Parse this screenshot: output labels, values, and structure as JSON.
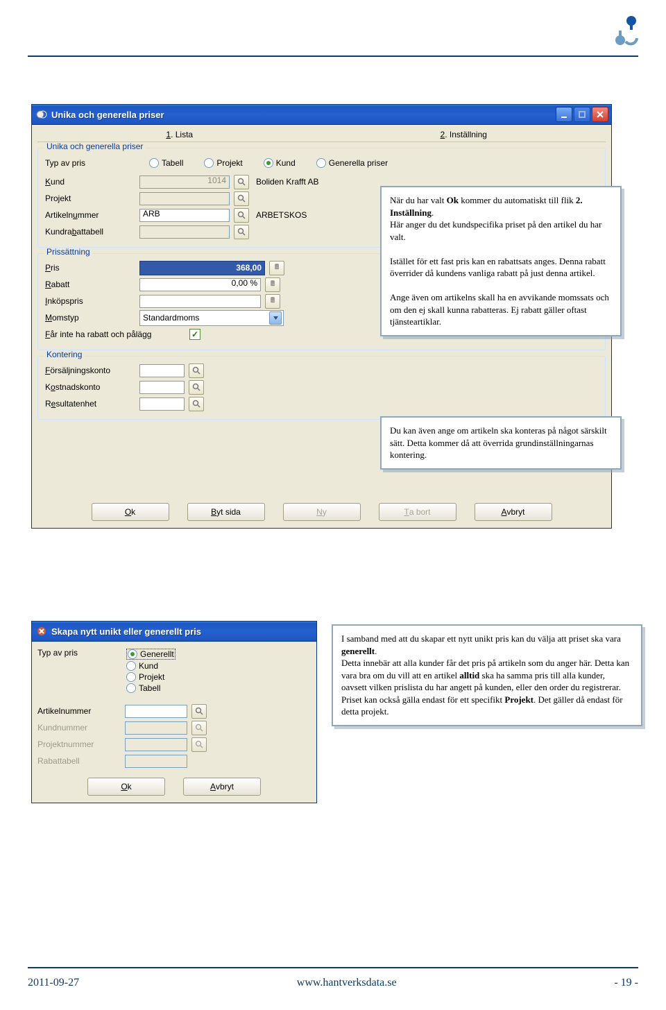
{
  "footer": {
    "date": "2011-09-27",
    "url": "www.hantverksdata.se",
    "page": "- 19 -"
  },
  "win1": {
    "title": "Unika och generella priser",
    "tabs": {
      "t1": "1. Lista",
      "t2": "2. Inställning"
    },
    "group1": {
      "legend": "Unika och generella priser",
      "typLabel": "Typ av pris",
      "radios": {
        "tabell": "Tabell",
        "projekt": "Projekt",
        "kund": "Kund",
        "generella": "Generella priser"
      },
      "kund": {
        "label": "Kund",
        "value": "1014",
        "name": "Boliden Krafft AB"
      },
      "projekt": {
        "label": "Projekt"
      },
      "artikelnummer": {
        "label": "Artikelnummer",
        "value": "ARB",
        "name": "ARBETSKOS"
      },
      "kundrabattabell": {
        "label": "Kundrabattabell"
      }
    },
    "group2": {
      "legend": "Prissättning",
      "pris": {
        "label": "Pris",
        "value": "368,00"
      },
      "rabatt": {
        "label": "Rabatt",
        "value": "0,00 %"
      },
      "inkop": {
        "label": "Inköpspris",
        "value": ""
      },
      "momstyp": {
        "label": "Momstyp",
        "value": "Standardmoms"
      },
      "farinte": {
        "label": "Får inte ha rabatt och pålägg"
      }
    },
    "group3": {
      "legend": "Kontering",
      "fors": {
        "label": "Försäljningskonto"
      },
      "kost": {
        "label": "Kostnadskonto"
      },
      "res": {
        "label": "Resultatenhet"
      }
    },
    "buttons": {
      "ok": "Ok",
      "byt": "Byt sida",
      "ny": "Ny",
      "tabort": "Ta bort",
      "avbryt": "Avbryt"
    }
  },
  "win2": {
    "title": "Skapa nytt unikt eller generellt pris",
    "typLabel": "Typ av pris",
    "radios": {
      "generellt": "Generellt",
      "kund": "Kund",
      "projekt": "Projekt",
      "tabell": "Tabell"
    },
    "fields": {
      "artikelnummer": "Artikelnummer",
      "kundnummer": "Kundnummer",
      "projektnummer": "Projektnummer",
      "rabattabell": "Rabattabell"
    },
    "buttons": {
      "ok": "Ok",
      "avbryt": "Avbryt"
    }
  },
  "callouts": {
    "c1": "När du har valt <b>Ok</b> kommer du automatiskt till flik <b>2. Inställning</b>.<br>Här anger du det kundspecifika priset på den artikel du har valt.<br><br>Istället för ett fast pris kan en rabattsats anges. Denna rabatt överrider då kundens vanliga rabatt på just denna artikel.<br><br>Ange även om artikelns skall ha en avvikande momssats och om den ej skall kunna rabatteras. Ej rabatt gäller oftast tjänsteartiklar.",
    "c2": "Du kan även ange om artikeln ska konteras på något särskilt sätt. Detta kommer då att överrida grundinställningarnas kontering.",
    "c3": "I samband med att du skapar ett nytt unikt pris kan du välja att priset ska vara <b>generellt</b>.<br>Detta innebär att alla kunder får det pris på artikeln som du anger här. Detta kan vara bra om du vill att en artikel <b>alltid</b> ska ha samma pris till alla kunder, oavsett vilken prislista du har angett på kunden, eller den order du registrerar.<br>Priset kan också gälla endast för ett specifikt <b>Projekt</b>. Det gäller då endast för detta projekt."
  }
}
